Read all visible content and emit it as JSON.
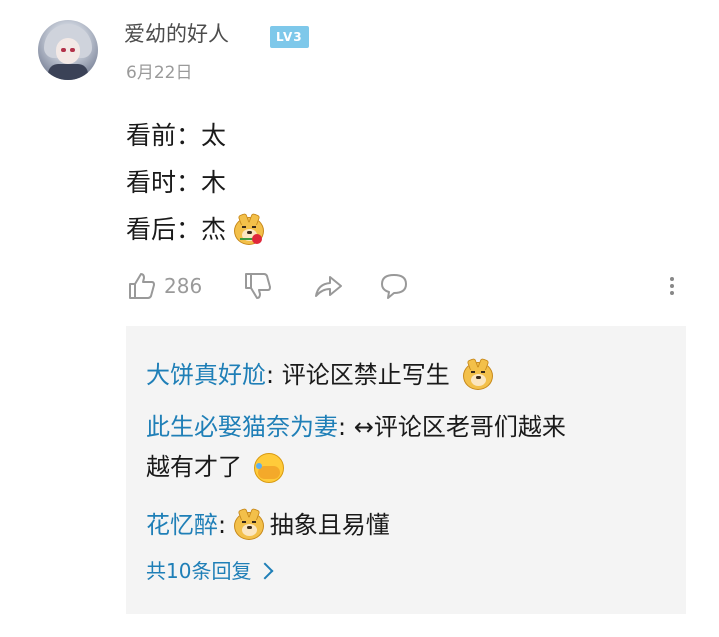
{
  "comment": {
    "username": "爱幼的好人",
    "level_badge": "LV3",
    "date": "6月22日",
    "lines": [
      {
        "text": "看前：太"
      },
      {
        "text": "看时：木"
      },
      {
        "text": "看后：杰"
      }
    ],
    "inline_emoji": "doge-rose-emoji",
    "likes": "286"
  },
  "actions": {
    "like_icon": "thumb-up-icon",
    "dislike_icon": "thumb-down-icon",
    "share_icon": "share-icon",
    "reply_icon": "chat-bubble-icon",
    "more_icon": "more-vertical-icon"
  },
  "replies": [
    {
      "name": "大饼真好尬",
      "text": "评论区禁止写生",
      "emoji": "doge-emoji"
    },
    {
      "name": "此生必娶猫奈为妻",
      "text": "↔评论区老哥们越来",
      "continuation": "越有才了",
      "emoji": "laughing-covering-face-emoji"
    },
    {
      "name": "花忆醉",
      "text": "抽象且易懂",
      "emoji": "doge-emoji"
    }
  ],
  "more_replies_label": "共10条回复",
  "colors": {
    "link": "#1f7fb7",
    "level_badge": "#7ec8ea",
    "muted": "#9a9a9a",
    "reply_bg": "#f4f4f4"
  }
}
